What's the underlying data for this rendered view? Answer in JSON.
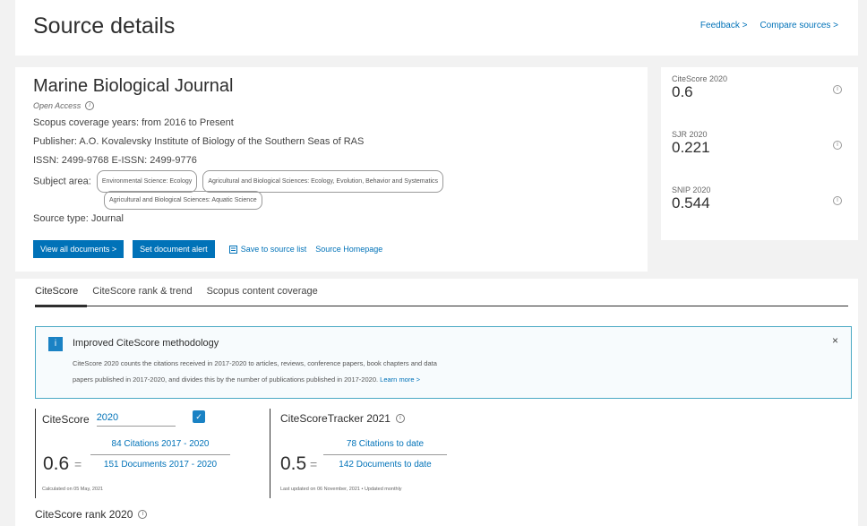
{
  "header": {
    "title": "Source details",
    "feedback_label": "Feedback >",
    "compare_label": "Compare sources >"
  },
  "source": {
    "title": "Marine Biological Journal",
    "open_access": "Open Access",
    "coverage_label": "Scopus coverage years:",
    "coverage_value": "from 2016 to Present",
    "publisher_label": "Publisher:",
    "publisher_value": "A.O. Kovalevsky Institute of Biology of the Southern Seas of RAS",
    "issn_label": "ISSN:",
    "issn_value": "2499-9768",
    "eissn_label": "E-ISSN:",
    "eissn_value": "2499-9776",
    "subject_label": "Subject area:",
    "subjects": [
      "Environmental Science: Ecology",
      "Agricultural and Biological Sciences: Ecology, Evolution, Behavior and Systematics",
      "Agricultural and Biological Sciences: Aquatic Science"
    ],
    "type_label": "Source type:",
    "type_value": "Journal"
  },
  "actions": {
    "view_all": "View all documents >",
    "set_alert": "Set document alert",
    "save_list": "Save to source list",
    "homepage": "Source Homepage"
  },
  "metrics": [
    {
      "label": "CiteScore 2020",
      "value": "0.6"
    },
    {
      "label": "SJR 2020",
      "value": "0.221"
    },
    {
      "label": "SNIP 2020",
      "value": "0.544"
    }
  ],
  "tabs": [
    "CiteScore",
    "CiteScore rank & trend",
    "Scopus content coverage"
  ],
  "notice": {
    "title": "Improved CiteScore methodology",
    "line1": "CiteScore 2020 counts the citations received in 2017-2020 to articles, reviews, conference papers, book chapters and data",
    "line2": "papers published in 2017-2020, and divides this by the number of publications published in 2017-2020.",
    "learn_more": "Learn more >"
  },
  "citescore": {
    "label": "CiteScore",
    "year": "2020",
    "value": "0.6",
    "eq": "=",
    "citations": "84 Citations 2017 - 2020",
    "documents": "151 Documents 2017 - 2020",
    "calc_note": "Calculated on 05 May, 2021"
  },
  "tracker": {
    "title": "CiteScoreTracker 2021",
    "value": "0.5",
    "eq": "=",
    "citations": "78 Citations to date",
    "documents": "142 Documents to date",
    "updated_note": "Last updated on 06 November, 2021 • Updated monthly"
  },
  "rank": {
    "title": "CiteScore rank 2020"
  }
}
